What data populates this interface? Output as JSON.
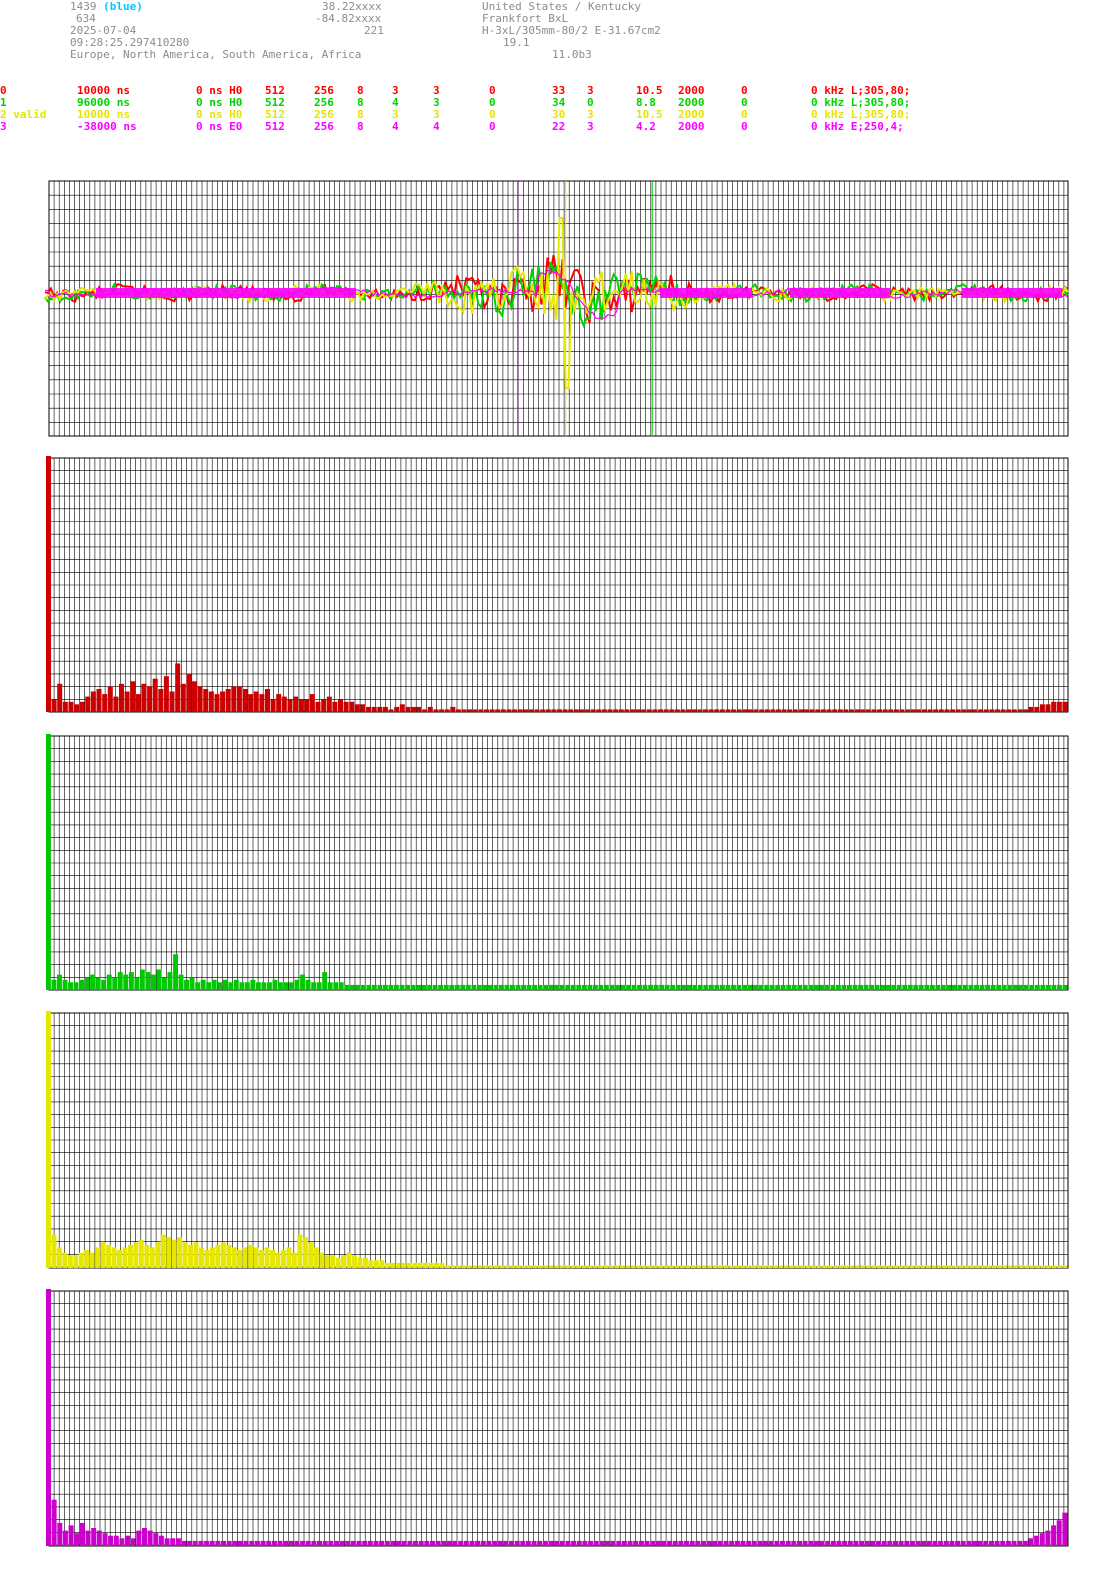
{
  "header": {
    "id": "1439",
    "id_tag": "(blue)",
    "line2": "634",
    "date": "2025-07-04",
    "time": "09:28:25.297410280",
    "regions": "Europe, North America, South America, Africa",
    "lat": "38.22xxxx",
    "lon": "-84.82xxxx",
    "alt": "221",
    "location": "United States / Kentucky",
    "station": "Frankfort BxL",
    "antenna": "H-3xL/305mm-80/2 E-31.67cm2",
    "value": "19.1",
    "version": "11.0b3"
  },
  "channels": [
    {
      "color": "#ff0000",
      "cols": [
        "0",
        "10000 ns",
        "0 ns H0",
        "512",
        "256",
        "8",
        "3",
        "3",
        "0",
        "33",
        "3",
        "10.5",
        "2000",
        "0",
        "0 kHz L;305,80;"
      ]
    },
    {
      "color": "#00d200",
      "cols": [
        "1",
        "96000 ns",
        "0 ns H0",
        "512",
        "256",
        "8",
        "4",
        "3",
        "0",
        "34",
        "0",
        "8.8",
        "2000",
        "0",
        "0 kHz L;305,80;"
      ]
    },
    {
      "color": "#e6e600",
      "cols": [
        "2 valid",
        "10000 ns",
        "0 ns H0",
        "512",
        "256",
        "8",
        "3",
        "3",
        "0",
        "30",
        "3",
        "10.5",
        "2000",
        "0",
        "0 kHz L;305,80;"
      ]
    },
    {
      "color": "#ff00ff",
      "cols": [
        "3",
        "-38000 ns",
        "0 ns E0",
        "512",
        "256",
        "8",
        "4",
        "4",
        "0",
        "22",
        "3",
        "4.2",
        "2000",
        "0",
        "0 kHz E;250,4;"
      ]
    }
  ],
  "chart_data": [
    {
      "type": "line",
      "description_markers": [
        {
          "color": "#cc00cc",
          "x": 0.46
        },
        {
          "color": "#e6e600",
          "x": 0.507
        },
        {
          "color": "#00d200",
          "x": 0.592
        }
      ],
      "series": [
        {
          "color": "#ff0000",
          "role": "channel-0",
          "seed": 1
        },
        {
          "color": "#00d200",
          "role": "channel-1",
          "seed": 2
        },
        {
          "color": "#e6e600",
          "role": "channel-2",
          "seed": 3
        },
        {
          "color": "#ff00ff",
          "role": "channel-3",
          "seed": 4
        }
      ],
      "ylim": [
        -1,
        1
      ],
      "grid": true
    },
    {
      "type": "bar",
      "color": "#cc0000",
      "peak": 1.0,
      "values": [
        1.0,
        0.05,
        0.11,
        0.04,
        0.04,
        0.03,
        0.04,
        0.06,
        0.08,
        0.09,
        0.07,
        0.1,
        0.06,
        0.11,
        0.08,
        0.12,
        0.07,
        0.11,
        0.1,
        0.13,
        0.09,
        0.14,
        0.08,
        0.19,
        0.11,
        0.15,
        0.12,
        0.1,
        0.09,
        0.08,
        0.07,
        0.08,
        0.09,
        0.1,
        0.1,
        0.09,
        0.07,
        0.08,
        0.07,
        0.09,
        0.05,
        0.07,
        0.06,
        0.05,
        0.06,
        0.05,
        0.05,
        0.07,
        0.04,
        0.05,
        0.06,
        0.04,
        0.05,
        0.04,
        0.04,
        0.03,
        0.03,
        0.02,
        0.02,
        0.02,
        0.02,
        0.01,
        0.02,
        0.03,
        0.02,
        0.02,
        0.02,
        0.01,
        0.02,
        0.01,
        0.01,
        0.01,
        0.02,
        0.01,
        0.01,
        0.01,
        0.01,
        0.01,
        0.01,
        0.01,
        0.01,
        0.01,
        0.01,
        0.01,
        0.01,
        0.01,
        0.01,
        0.01,
        0.01,
        0.01,
        0.01,
        0.01,
        0.01,
        0.01,
        0.01,
        0.01,
        0.01,
        0.01,
        0.01,
        0.01,
        0.01,
        0.01,
        0.01,
        0.01,
        0.01,
        0.01,
        0.01,
        0.01,
        0.01,
        0.01,
        0.01,
        0.01,
        0.01,
        0.01,
        0.01,
        0.01,
        0.01,
        0.01,
        0.01,
        0.01,
        0.01,
        0.01,
        0.01,
        0.01,
        0.01,
        0.01,
        0.01,
        0.01,
        0.01,
        0.01,
        0.01,
        0.01,
        0.01,
        0.01,
        0.01,
        0.01,
        0.01,
        0.01,
        0.01,
        0.01,
        0.01,
        0.01,
        0.01,
        0.01,
        0.01,
        0.01,
        0.01,
        0.01,
        0.01,
        0.01,
        0.01,
        0.01,
        0.01,
        0.01,
        0.01,
        0.01,
        0.01,
        0.01,
        0.01,
        0.01,
        0.01,
        0.01,
        0.01,
        0.01,
        0.01,
        0.01,
        0.01,
        0.01,
        0.01,
        0.01,
        0.01,
        0.01,
        0.01,
        0.01,
        0.01,
        0.02,
        0.02,
        0.03,
        0.03,
        0.04,
        0.04,
        0.04
      ]
    },
    {
      "type": "bar",
      "color": "#00c800",
      "peak": 1.0,
      "values": [
        1.0,
        0.04,
        0.06,
        0.04,
        0.03,
        0.03,
        0.04,
        0.05,
        0.06,
        0.05,
        0.04,
        0.06,
        0.05,
        0.07,
        0.06,
        0.07,
        0.05,
        0.08,
        0.07,
        0.06,
        0.08,
        0.05,
        0.07,
        0.14,
        0.06,
        0.04,
        0.05,
        0.03,
        0.04,
        0.03,
        0.04,
        0.03,
        0.04,
        0.03,
        0.04,
        0.03,
        0.03,
        0.04,
        0.03,
        0.03,
        0.03,
        0.04,
        0.03,
        0.03,
        0.03,
        0.04,
        0.06,
        0.04,
        0.03,
        0.03,
        0.07,
        0.03,
        0.03,
        0.03,
        0.02,
        0.02,
        0.02,
        0.02,
        0.02,
        0.02,
        0.02,
        0.02,
        0.02,
        0.02,
        0.02,
        0.02,
        0.02,
        0.02,
        0.02,
        0.02,
        0.02,
        0.02,
        0.02,
        0.02,
        0.02,
        0.02,
        0.02,
        0.02,
        0.02,
        0.02,
        0.02,
        0.02,
        0.02,
        0.02,
        0.02,
        0.02,
        0.02,
        0.02,
        0.02,
        0.02,
        0.02,
        0.02,
        0.02,
        0.02,
        0.02,
        0.02,
        0.02,
        0.02,
        0.02,
        0.02,
        0.02,
        0.02,
        0.02,
        0.02,
        0.02,
        0.02,
        0.02,
        0.02,
        0.02,
        0.02,
        0.02,
        0.02,
        0.02,
        0.02,
        0.02,
        0.02,
        0.02,
        0.02,
        0.02,
        0.02,
        0.02,
        0.02,
        0.02,
        0.02,
        0.02,
        0.02,
        0.02,
        0.02,
        0.02,
        0.02,
        0.02,
        0.02,
        0.02,
        0.02,
        0.02,
        0.02,
        0.02,
        0.02,
        0.02,
        0.02,
        0.02,
        0.02,
        0.02,
        0.02,
        0.02,
        0.02,
        0.02,
        0.02,
        0.02,
        0.02,
        0.02,
        0.02,
        0.02,
        0.02,
        0.02,
        0.02,
        0.02,
        0.02,
        0.02,
        0.02,
        0.02,
        0.02,
        0.02,
        0.02,
        0.02,
        0.02,
        0.02,
        0.02,
        0.02,
        0.02,
        0.02,
        0.02,
        0.02,
        0.02,
        0.02,
        0.02,
        0.02,
        0.02,
        0.02,
        0.02,
        0.02,
        0.02,
        0.02,
        0.02,
        0.02
      ]
    },
    {
      "type": "bar",
      "color": "#e6e600",
      "peak": 1.0,
      "values": [
        1.0,
        0.13,
        0.08,
        0.06,
        0.05,
        0.05,
        0.06,
        0.07,
        0.06,
        0.08,
        0.1,
        0.09,
        0.08,
        0.07,
        0.08,
        0.09,
        0.1,
        0.11,
        0.09,
        0.08,
        0.1,
        0.13,
        0.12,
        0.11,
        0.12,
        0.1,
        0.09,
        0.1,
        0.08,
        0.07,
        0.08,
        0.09,
        0.1,
        0.09,
        0.08,
        0.07,
        0.08,
        0.09,
        0.08,
        0.07,
        0.08,
        0.07,
        0.06,
        0.07,
        0.08,
        0.06,
        0.13,
        0.12,
        0.1,
        0.08,
        0.06,
        0.05,
        0.05,
        0.04,
        0.05,
        0.06,
        0.05,
        0.04,
        0.04,
        0.03,
        0.03,
        0.03,
        0.02,
        0.02,
        0.02,
        0.02,
        0.02,
        0.02,
        0.02,
        0.02,
        0.02,
        0.02,
        0.02,
        0.01,
        0.01,
        0.01,
        0.01,
        0.01,
        0.01,
        0.01,
        0.01,
        0.01,
        0.01,
        0.01,
        0.01,
        0.01,
        0.01,
        0.01,
        0.01,
        0.01,
        0.01,
        0.01,
        0.01,
        0.01,
        0.01,
        0.01,
        0.01,
        0.01,
        0.01,
        0.01,
        0.01,
        0.01,
        0.01,
        0.01,
        0.01,
        0.01,
        0.01,
        0.01,
        0.01,
        0.01,
        0.01,
        0.01,
        0.01,
        0.01,
        0.01,
        0.01,
        0.01,
        0.01,
        0.01,
        0.01,
        0.01,
        0.01,
        0.01,
        0.01,
        0.01,
        0.01,
        0.01,
        0.01,
        0.01,
        0.01,
        0.01,
        0.01,
        0.01,
        0.01,
        0.01,
        0.01,
        0.01,
        0.01,
        0.01,
        0.01,
        0.01,
        0.01,
        0.01,
        0.01,
        0.01,
        0.01,
        0.01,
        0.01,
        0.01,
        0.01,
        0.01,
        0.01,
        0.01,
        0.01,
        0.01,
        0.01,
        0.01,
        0.01,
        0.01,
        0.01,
        0.01,
        0.01,
        0.01,
        0.01,
        0.01,
        0.01,
        0.01,
        0.01,
        0.01,
        0.01,
        0.01,
        0.01,
        0.01,
        0.01,
        0.01,
        0.01,
        0.01,
        0.01,
        0.01,
        0.01,
        0.01,
        0.01,
        0.01,
        0.01,
        0.01,
        0.01,
        0.01
      ]
    },
    {
      "type": "bar",
      "color": "#cc00cc",
      "peak": 1.0,
      "values": [
        1.0,
        0.18,
        0.09,
        0.06,
        0.08,
        0.05,
        0.09,
        0.06,
        0.07,
        0.06,
        0.05,
        0.04,
        0.04,
        0.03,
        0.04,
        0.03,
        0.06,
        0.07,
        0.06,
        0.05,
        0.04,
        0.03,
        0.03,
        0.03,
        0.02,
        0.02,
        0.02,
        0.02,
        0.02,
        0.02,
        0.02,
        0.02,
        0.02,
        0.02,
        0.02,
        0.02,
        0.02,
        0.02,
        0.02,
        0.02,
        0.02,
        0.02,
        0.02,
        0.02,
        0.02,
        0.02,
        0.02,
        0.02,
        0.02,
        0.02,
        0.02,
        0.02,
        0.02,
        0.02,
        0.02,
        0.02,
        0.02,
        0.02,
        0.02,
        0.02,
        0.02,
        0.02,
        0.02,
        0.02,
        0.02,
        0.02,
        0.02,
        0.02,
        0.02,
        0.02,
        0.02,
        0.02,
        0.02,
        0.02,
        0.02,
        0.02,
        0.02,
        0.02,
        0.02,
        0.02,
        0.02,
        0.02,
        0.02,
        0.02,
        0.02,
        0.02,
        0.02,
        0.02,
        0.02,
        0.02,
        0.02,
        0.02,
        0.02,
        0.02,
        0.02,
        0.02,
        0.02,
        0.02,
        0.02,
        0.02,
        0.02,
        0.02,
        0.02,
        0.02,
        0.02,
        0.02,
        0.02,
        0.02,
        0.02,
        0.02,
        0.02,
        0.02,
        0.02,
        0.02,
        0.02,
        0.02,
        0.02,
        0.02,
        0.02,
        0.02,
        0.02,
        0.02,
        0.02,
        0.02,
        0.02,
        0.02,
        0.02,
        0.02,
        0.02,
        0.02,
        0.02,
        0.02,
        0.02,
        0.02,
        0.02,
        0.02,
        0.02,
        0.02,
        0.02,
        0.02,
        0.02,
        0.02,
        0.02,
        0.02,
        0.02,
        0.02,
        0.02,
        0.02,
        0.02,
        0.02,
        0.02,
        0.02,
        0.02,
        0.02,
        0.02,
        0.02,
        0.02,
        0.02,
        0.02,
        0.02,
        0.02,
        0.02,
        0.02,
        0.02,
        0.02,
        0.02,
        0.02,
        0.02,
        0.02,
        0.02,
        0.02,
        0.02,
        0.02,
        0.02,
        0.03,
        0.04,
        0.05,
        0.06,
        0.08,
        0.1,
        0.13
      ]
    }
  ]
}
